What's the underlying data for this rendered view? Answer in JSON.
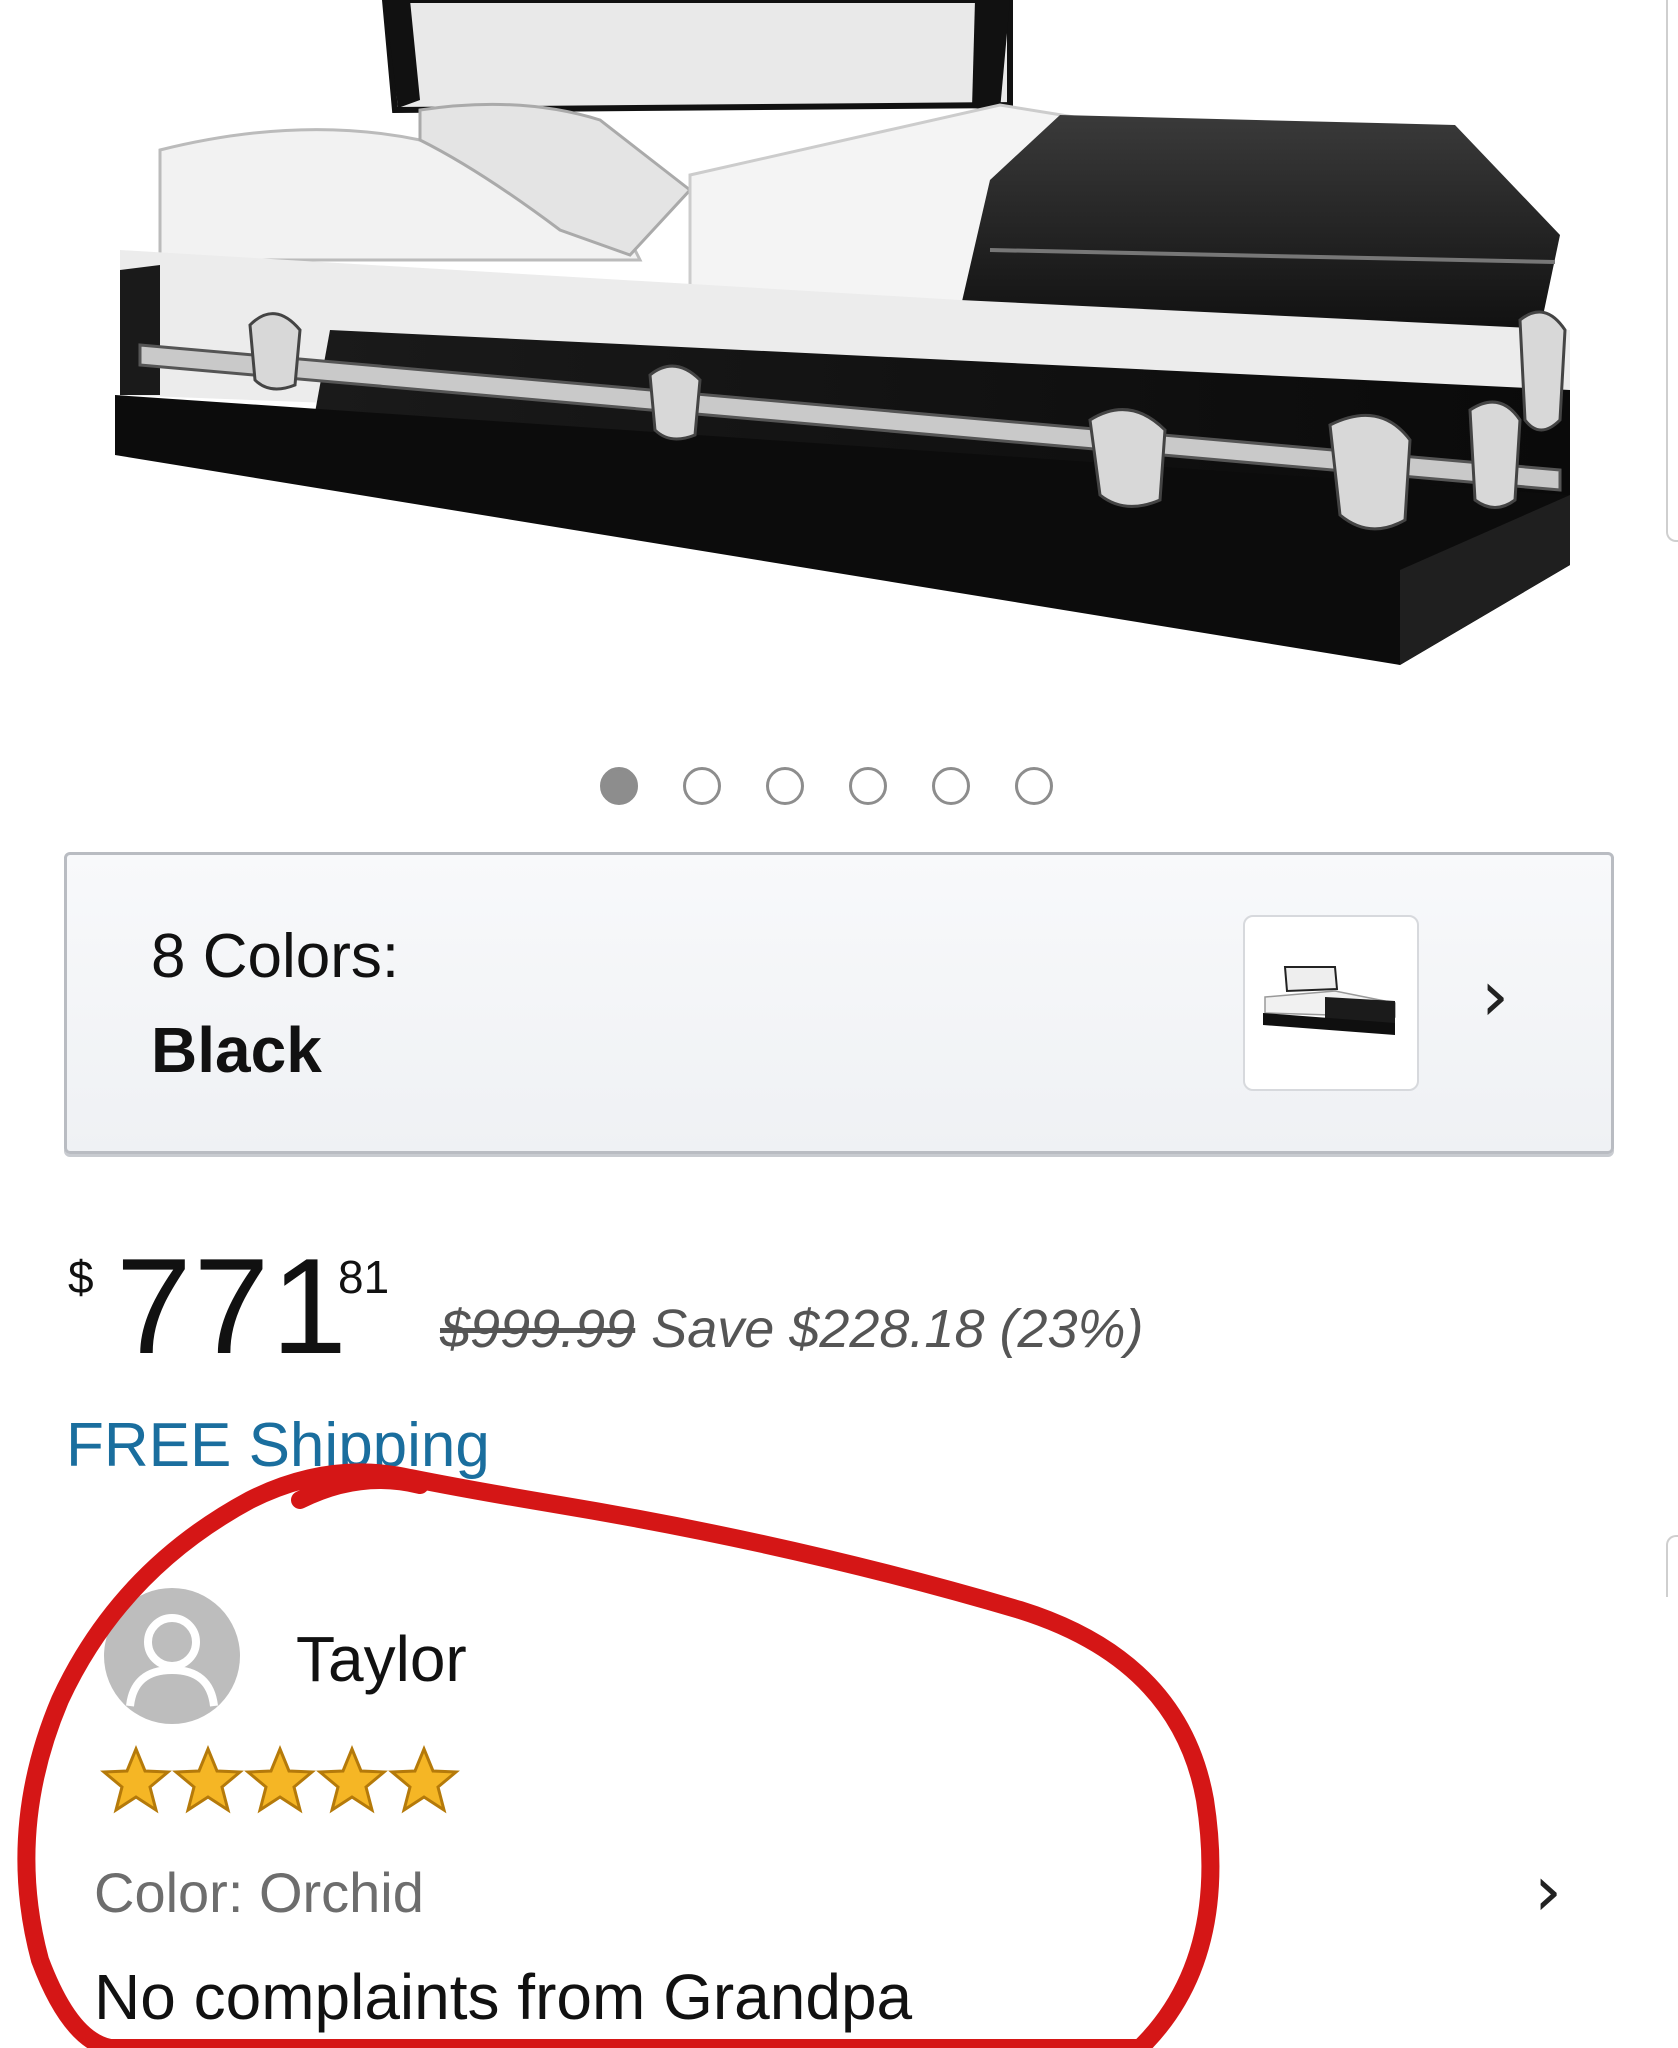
{
  "carousel": {
    "slide_count": 6,
    "active_index": 0
  },
  "color_selector": {
    "count_label": "8 Colors:",
    "selected": "Black"
  },
  "price": {
    "currency": "$",
    "whole": "771",
    "cents": "81",
    "list_price": "$999.99",
    "savings": "Save $228.18 (23%)",
    "shipping": "FREE Shipping"
  },
  "review": {
    "reviewer": "Taylor",
    "rating": 5,
    "rating_max": 5,
    "color": "Color: Orchid",
    "text": "No complaints from Grandpa"
  },
  "colors": {
    "link_blue": "#1a6e9e",
    "star_gold": "#f5b625",
    "annotation_red": "#d51616"
  },
  "icons": [
    "chevron-right-icon",
    "avatar-icon",
    "star-icon"
  ]
}
